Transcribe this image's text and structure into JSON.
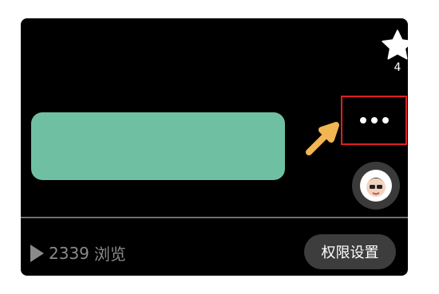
{
  "favorite": {
    "icon": "star-icon",
    "count": "4"
  },
  "more": {
    "icon": "more-dots-icon",
    "highlight_color": "#e02020"
  },
  "hint_arrow": {
    "icon": "arrow-pointer-icon",
    "color": "#f2b553"
  },
  "masked_region_color": "#6fc0a3",
  "avatar": {
    "icon": "avatar-icon"
  },
  "stats": {
    "views_count": "2339",
    "views_label": "浏览",
    "icon": "play-icon"
  },
  "permission_button": {
    "label": "权限设置"
  }
}
